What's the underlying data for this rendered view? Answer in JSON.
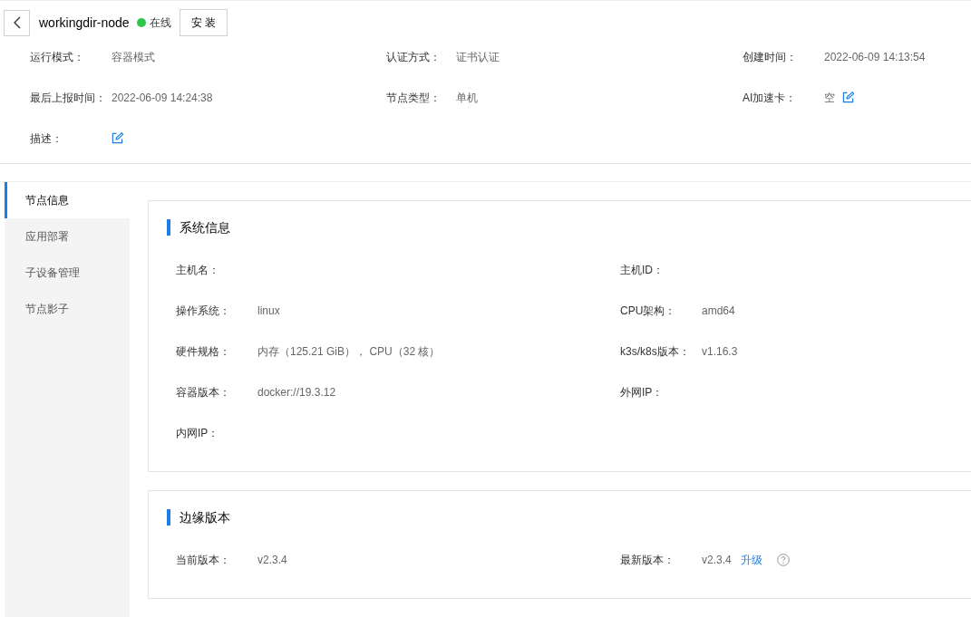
{
  "header": {
    "title": "workingdir-node",
    "status": {
      "text": "在线",
      "online": true
    },
    "install_button": "安 装"
  },
  "meta": [
    {
      "label": "运行模式：",
      "value": "容器模式"
    },
    {
      "label": "认证方式：",
      "value": "证书认证"
    },
    {
      "label": "创建时间：",
      "value": "2022-06-09 14:13:54"
    },
    {
      "label": "最后上报时间：",
      "value": "2022-06-09 14:24:38"
    },
    {
      "label": "节点类型：",
      "value": "单机"
    },
    {
      "label": "AI加速卡：",
      "value": "空",
      "editable": true
    },
    {
      "label": "描述：",
      "editable": true
    }
  ],
  "tabs": [
    {
      "label": "节点信息",
      "selected": true
    },
    {
      "label": "应用部署",
      "selected": false
    },
    {
      "label": "子设备管理",
      "selected": false
    },
    {
      "label": "节点影子",
      "selected": false
    }
  ],
  "sections": [
    {
      "title": "系统信息",
      "fields": [
        {
          "label": "主机名："
        },
        {
          "label": "主机ID："
        },
        {
          "label": "操作系统：",
          "value": "linux"
        },
        {
          "label": "CPU架构：",
          "value": "amd64"
        },
        {
          "label": "硬件规格：",
          "value": "内存（125.21 GiB）， CPU（32 核）"
        },
        {
          "label": "k3s/k8s版本：",
          "value": "v1.16.3"
        },
        {
          "label": "容器版本：",
          "value": "docker://19.3.12"
        },
        {
          "label": "外网IP："
        },
        {
          "label": "内网IP："
        }
      ]
    },
    {
      "title": "边缘版本",
      "fields": [
        {
          "label": "当前版本：",
          "value": "v2.3.4"
        },
        {
          "label": "最新版本：",
          "value": "v2.3.4",
          "action": "升级",
          "help": true
        }
      ]
    }
  ]
}
